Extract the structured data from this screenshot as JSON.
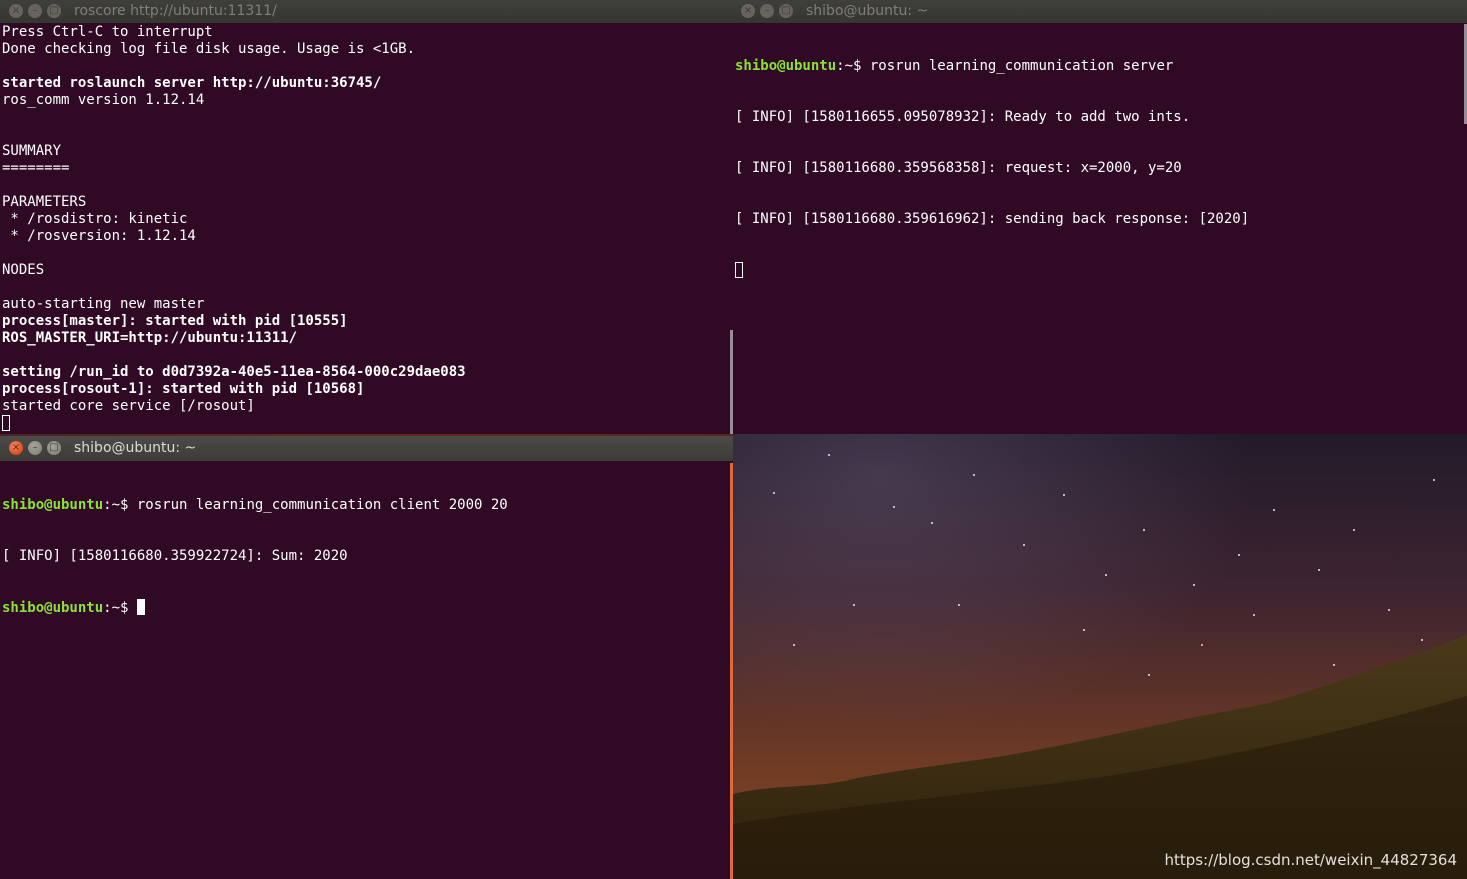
{
  "windows": {
    "roscore": {
      "title": "roscore http://ubuntu:11311/",
      "lines": [
        {
          "text": "Press Ctrl-C to interrupt",
          "bold": false
        },
        {
          "text": "Done checking log file disk usage. Usage is <1GB.",
          "bold": false
        },
        {
          "text": "",
          "bold": false
        },
        {
          "text": "started roslaunch server http://ubuntu:36745/",
          "bold": true
        },
        {
          "text": "ros_comm version 1.12.14",
          "bold": false
        },
        {
          "text": "",
          "bold": false
        },
        {
          "text": "",
          "bold": false
        },
        {
          "text": "SUMMARY",
          "bold": false
        },
        {
          "text": "========",
          "bold": false
        },
        {
          "text": "",
          "bold": false
        },
        {
          "text": "PARAMETERS",
          "bold": false
        },
        {
          "text": " * /rosdistro: kinetic",
          "bold": false
        },
        {
          "text": " * /rosversion: 1.12.14",
          "bold": false
        },
        {
          "text": "",
          "bold": false
        },
        {
          "text": "NODES",
          "bold": false
        },
        {
          "text": "",
          "bold": false
        },
        {
          "text": "auto-starting new master",
          "bold": false
        },
        {
          "text": "process[master]: started with pid [10555]",
          "bold": true
        },
        {
          "text": "ROS_MASTER_URI=http://ubuntu:11311/",
          "bold": true
        },
        {
          "text": "",
          "bold": false
        },
        {
          "text": "setting /run_id to d0d7392a-40e5-11ea-8564-000c29dae083",
          "bold": true
        },
        {
          "text": "process[rosout-1]: started with pid [10568]",
          "bold": true
        },
        {
          "text": "started core service [/rosout]",
          "bold": false
        }
      ]
    },
    "server": {
      "title": "shibo@ubuntu: ~",
      "prompt_user": "shibo@ubuntu",
      "prompt_path": ":~$ ",
      "command": "rosrun learning_communication server",
      "output": [
        "[ INFO] [1580116655.095078932]: Ready to add two ints.",
        "[ INFO] [1580116680.359568358]: request: x=2000, y=20",
        "[ INFO] [1580116680.359616962]: sending back response: [2020]"
      ]
    },
    "client": {
      "title": "shibo@ubuntu: ~",
      "prompt_user": "shibo@ubuntu",
      "prompt_path": ":~$ ",
      "command": "rosrun learning_communication client 2000 20",
      "output": [
        "[ INFO] [1580116680.359922724]: Sum: 2020"
      ]
    }
  },
  "titlebar_buttons": {
    "close": "×",
    "minimize": "–",
    "maximize": "□"
  },
  "watermark": "https://blog.csdn.net/weixin_44827364",
  "colors": {
    "terminal_bg": "#300a24",
    "prompt_green": "#8ae234",
    "close_orange": "#e6572b"
  }
}
